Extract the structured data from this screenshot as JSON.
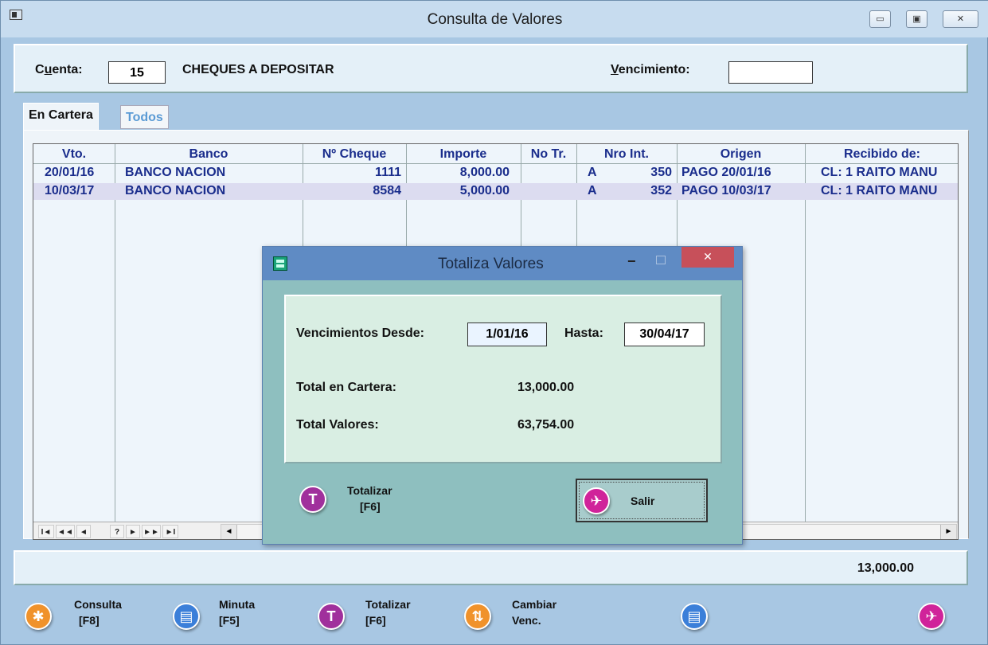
{
  "window": {
    "title": "Consulta de Valores"
  },
  "cuenta": {
    "label": "Cuenta:",
    "label_accel": "u",
    "value": "15",
    "name": "CHEQUES A DEPOSITAR",
    "vencimiento_label": "Vencimiento:",
    "vencimiento_accel": "V",
    "vencimiento_value": ""
  },
  "tabs": [
    {
      "label": "En Cartera",
      "active": true
    },
    {
      "label": "Todos",
      "active": false
    }
  ],
  "grid": {
    "columns": [
      "Vto.",
      "Banco",
      "Nº Cheque",
      "Importe",
      "No Tr.",
      "Nro Int.",
      "Origen",
      "Recibido de:"
    ],
    "rows": [
      {
        "vto": "20/01/16",
        "banco": "BANCO NACION",
        "cheque": "1111",
        "importe": "8,000.00",
        "notr": "",
        "nroint_letter": "A",
        "nroint_num": "350",
        "origen": "PAGO 20/01/16",
        "recibido": "CL: 1 RAITO MANU"
      },
      {
        "vto": "10/03/17",
        "banco": "BANCO NACION",
        "cheque": "8584",
        "importe": "5,000.00",
        "notr": "",
        "nroint_letter": "A",
        "nroint_num": "352",
        "origen": "PAGO 10/03/17",
        "recibido": "CL: 1 RAITO MANU"
      }
    ],
    "nav": [
      "I◄",
      "◄◄",
      "◄",
      "?",
      "►",
      "►►",
      "►I"
    ]
  },
  "footer_total": "13,000.00",
  "toolbar": [
    {
      "line1": "Consulta",
      "line2": "[F8]",
      "icon": "star-icon",
      "color": "#f0922b"
    },
    {
      "line1": "Minuta",
      "line2": "[F5]",
      "icon": "document-icon",
      "color": "#3b7fd9"
    },
    {
      "line1": "Totalizar",
      "line2": "[F6]",
      "icon": "total-icon",
      "color": "#a0309c"
    },
    {
      "line1": "Cambiar",
      "line2": "Venc.",
      "icon": "swap-icon",
      "color": "#f0922b"
    },
    {
      "line1": "",
      "line2": "",
      "icon": "document-icon",
      "color": "#3b7fd9"
    },
    {
      "line1": "",
      "line2": "",
      "icon": "exit-walker-icon",
      "color": "#d0239a"
    }
  ],
  "dialog": {
    "title": "Totaliza Valores",
    "desde_label": "Vencimientos Desde:",
    "desde_value": "1/01/16",
    "hasta_label": "Hasta:",
    "hasta_value": "30/04/17",
    "cartera_label": "Total en Cartera:",
    "cartera_value": "13,000.00",
    "valores_label": "Total Valores:",
    "valores_value": "63,754.00",
    "totalizar_line1": "Totalizar",
    "totalizar_line2": "[F6]",
    "salir_label": "Salir"
  }
}
